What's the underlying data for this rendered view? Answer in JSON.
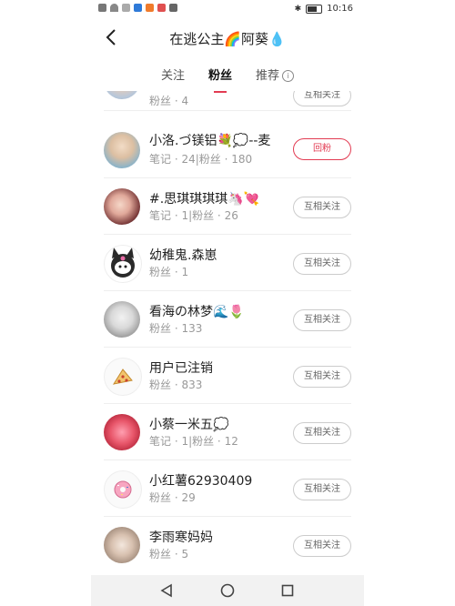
{
  "status_bar": {
    "time": "10:16"
  },
  "header": {
    "back_icon": "back-arrow-icon",
    "title": "在逃公主🌈阿葵💧"
  },
  "tabs": [
    {
      "label": "关注",
      "active": false
    },
    {
      "label": "粉丝",
      "active": true
    },
    {
      "label": "推荐",
      "active": false
    }
  ],
  "followers": [
    {
      "name": "",
      "meta": "粉丝 · 4",
      "button": "互相关注",
      "avatar": "avatar-girl-photo",
      "partial": true
    },
    {
      "name": "小洛.づ镁铝💐💭--麦",
      "meta": "笔记 · 24|粉丝 · 180",
      "button": "回粉",
      "primary": true,
      "avatar": "avatar-photo"
    },
    {
      "name": "#.思琪琪琪琪🦄💘",
      "meta": "笔记 · 1|粉丝 · 26",
      "button": "互相关注",
      "avatar": "avatar-selfie"
    },
    {
      "name": "幼稚鬼.森崽",
      "meta": "粉丝 · 1",
      "button": "互相关注",
      "avatar": "avatar-kuromi"
    },
    {
      "name": "看海の林梦🌊🌷",
      "meta": "粉丝 · 133",
      "button": "互相关注",
      "avatar": "avatar-anime-girl"
    },
    {
      "name": "用户已注销",
      "meta": "粉丝 · 833",
      "button": "互相关注",
      "avatar": "avatar-pizza"
    },
    {
      "name": "小蔡一米五💭",
      "meta": "笔记 · 1|粉丝 · 12",
      "button": "互相关注",
      "avatar": "avatar-strawberry-bear"
    },
    {
      "name": "小红薯62930409",
      "meta": "粉丝 · 29",
      "button": "互相关注",
      "avatar": "avatar-donut"
    },
    {
      "name": "李雨寒妈妈",
      "meta": "粉丝 · 5",
      "button": "互相关注",
      "avatar": "avatar-photo-family"
    }
  ],
  "colors": {
    "accent": "#e23b52"
  }
}
